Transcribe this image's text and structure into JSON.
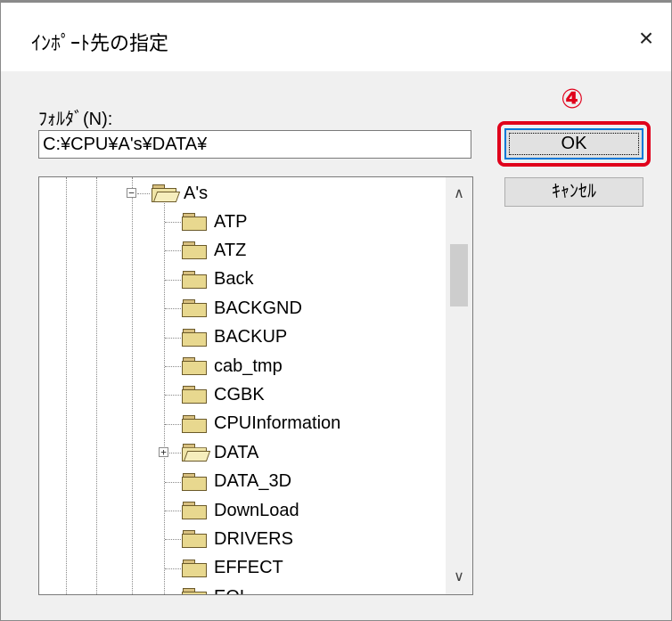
{
  "dialog": {
    "title": "ｲﾝﾎﾟｰﾄ先の指定",
    "close_icon": "×"
  },
  "folder_field": {
    "label": "ﾌｫﾙﾀﾞ(N):",
    "value": "C:¥CPU¥A's¥DATA¥"
  },
  "annotation": {
    "step": "④",
    "highlight_color": "#e0001b"
  },
  "buttons": {
    "ok": "OK",
    "cancel": "ｷｬﾝｾﾙ"
  },
  "tree": {
    "parent": "A's",
    "parent_expander": "−",
    "children": [
      {
        "label": "ATP"
      },
      {
        "label": "ATZ"
      },
      {
        "label": "Back"
      },
      {
        "label": "BACKGND"
      },
      {
        "label": "BACKUP"
      },
      {
        "label": "cab_tmp"
      },
      {
        "label": "CGBK"
      },
      {
        "label": "CPUInformation"
      },
      {
        "label": "DATA",
        "expander": "+",
        "open": true
      },
      {
        "label": "DATA_3D"
      },
      {
        "label": "DownLoad"
      },
      {
        "label": "DRIVERS"
      },
      {
        "label": "EFFECT"
      },
      {
        "label": "EOL"
      }
    ]
  },
  "scrollbar": {
    "up_icon": "∧",
    "down_icon": "∨"
  },
  "colors": {
    "folder_fill": "#e8d88f",
    "focus_blue": "#0078d7"
  }
}
